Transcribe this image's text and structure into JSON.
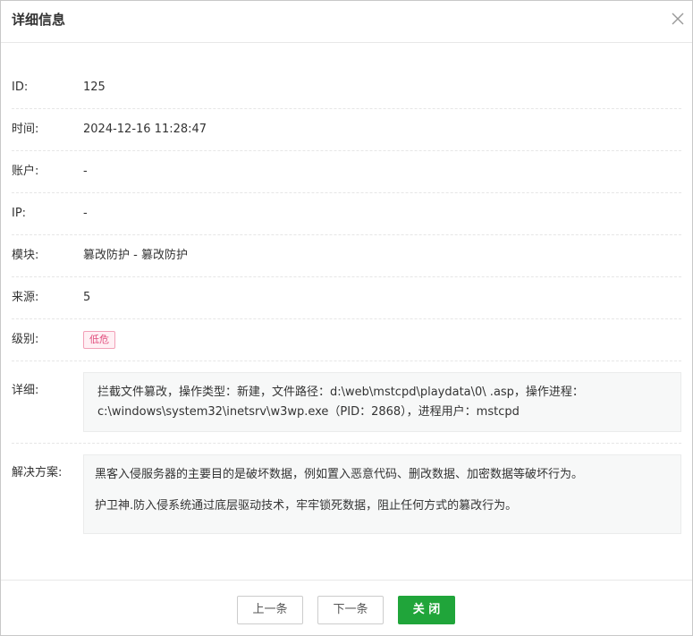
{
  "dialog": {
    "title": "详细信息"
  },
  "fields": {
    "id": {
      "label": "ID:",
      "value": "125"
    },
    "time": {
      "label": "时间:",
      "value": "2024-12-16 11:28:47"
    },
    "account": {
      "label": "账户:",
      "value": "-"
    },
    "ip": {
      "label": "IP:",
      "value": "-"
    },
    "module": {
      "label": "模块:",
      "value": "篡改防护 - 篡改防护"
    },
    "source": {
      "label": "来源:",
      "value": "5"
    },
    "level": {
      "label": "级别:",
      "value": "低危",
      "color": "#e04e7d"
    },
    "detail": {
      "label": "详细:",
      "value": "拦截文件篡改，操作类型：新建，文件路径：d:\\web\\mstcpd\\playdata\\0\\ .asp，操作进程：c:\\windows\\system32\\inetsrv\\w3wp.exe（PID：2868），进程用户：mstcpd"
    },
    "solution": {
      "label": "解决方案:",
      "lines": [
        "黑客入侵服务器的主要目的是破坏数据，例如置入恶意代码、删改数据、加密数据等破坏行为。",
        "护卫神.防入侵系统通过底层驱动技术，牢牢锁死数据，阻止任何方式的篡改行为。"
      ]
    }
  },
  "footer": {
    "prev_label": "上一条",
    "next_label": "下一条",
    "close_label": "关 闭",
    "primary_color": "#20a53a"
  },
  "icons": {
    "close": "close-icon"
  }
}
